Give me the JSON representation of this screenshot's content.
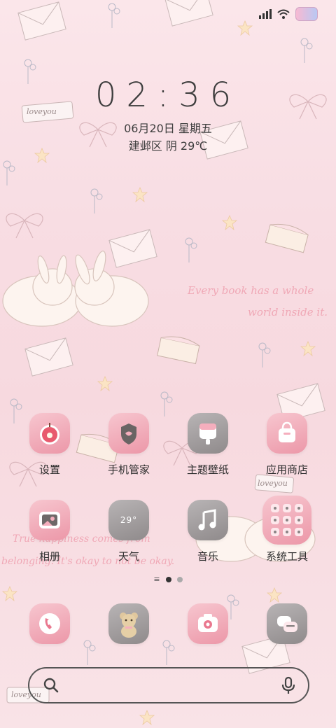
{
  "status": {
    "icons": [
      "signal-icon",
      "wifi-icon",
      "battery-icon"
    ]
  },
  "lockscreen": {
    "time": "02:36",
    "date": "06月20日 星期五",
    "weather": "建邺区 阴 29℃"
  },
  "wallpaper": {
    "quote1_line1": "Every book has a whole",
    "quote1_line2": "world inside it.",
    "quote2_line1": "True happiness comes from",
    "quote2_line2": "belonging. It's okay to not be okay.",
    "stamp": "loveyou"
  },
  "apps": {
    "row1": [
      {
        "label": "设置",
        "icon": "apple-icon"
      },
      {
        "label": "手机管家",
        "icon": "shield-icon"
      },
      {
        "label": "主题壁纸",
        "icon": "theme-icon"
      },
      {
        "label": "应用商店",
        "icon": "bag-icon"
      }
    ],
    "row2": [
      {
        "label": "相册",
        "icon": "photo-icon"
      },
      {
        "label": "天气",
        "icon": "weather-icon",
        "glyph": "29°"
      },
      {
        "label": "音乐",
        "icon": "music-icon"
      },
      {
        "label": "系统工具",
        "icon": "folder-icon"
      }
    ]
  },
  "dock": [
    {
      "icon": "phone-icon"
    },
    {
      "icon": "teddy-icon"
    },
    {
      "icon": "camera-icon"
    },
    {
      "icon": "message-icon"
    }
  ],
  "page_indicator": {
    "pages": 2,
    "current": 1
  },
  "colors": {
    "accent_pink": "#ec97a8",
    "grey": "#8f8a8b"
  }
}
